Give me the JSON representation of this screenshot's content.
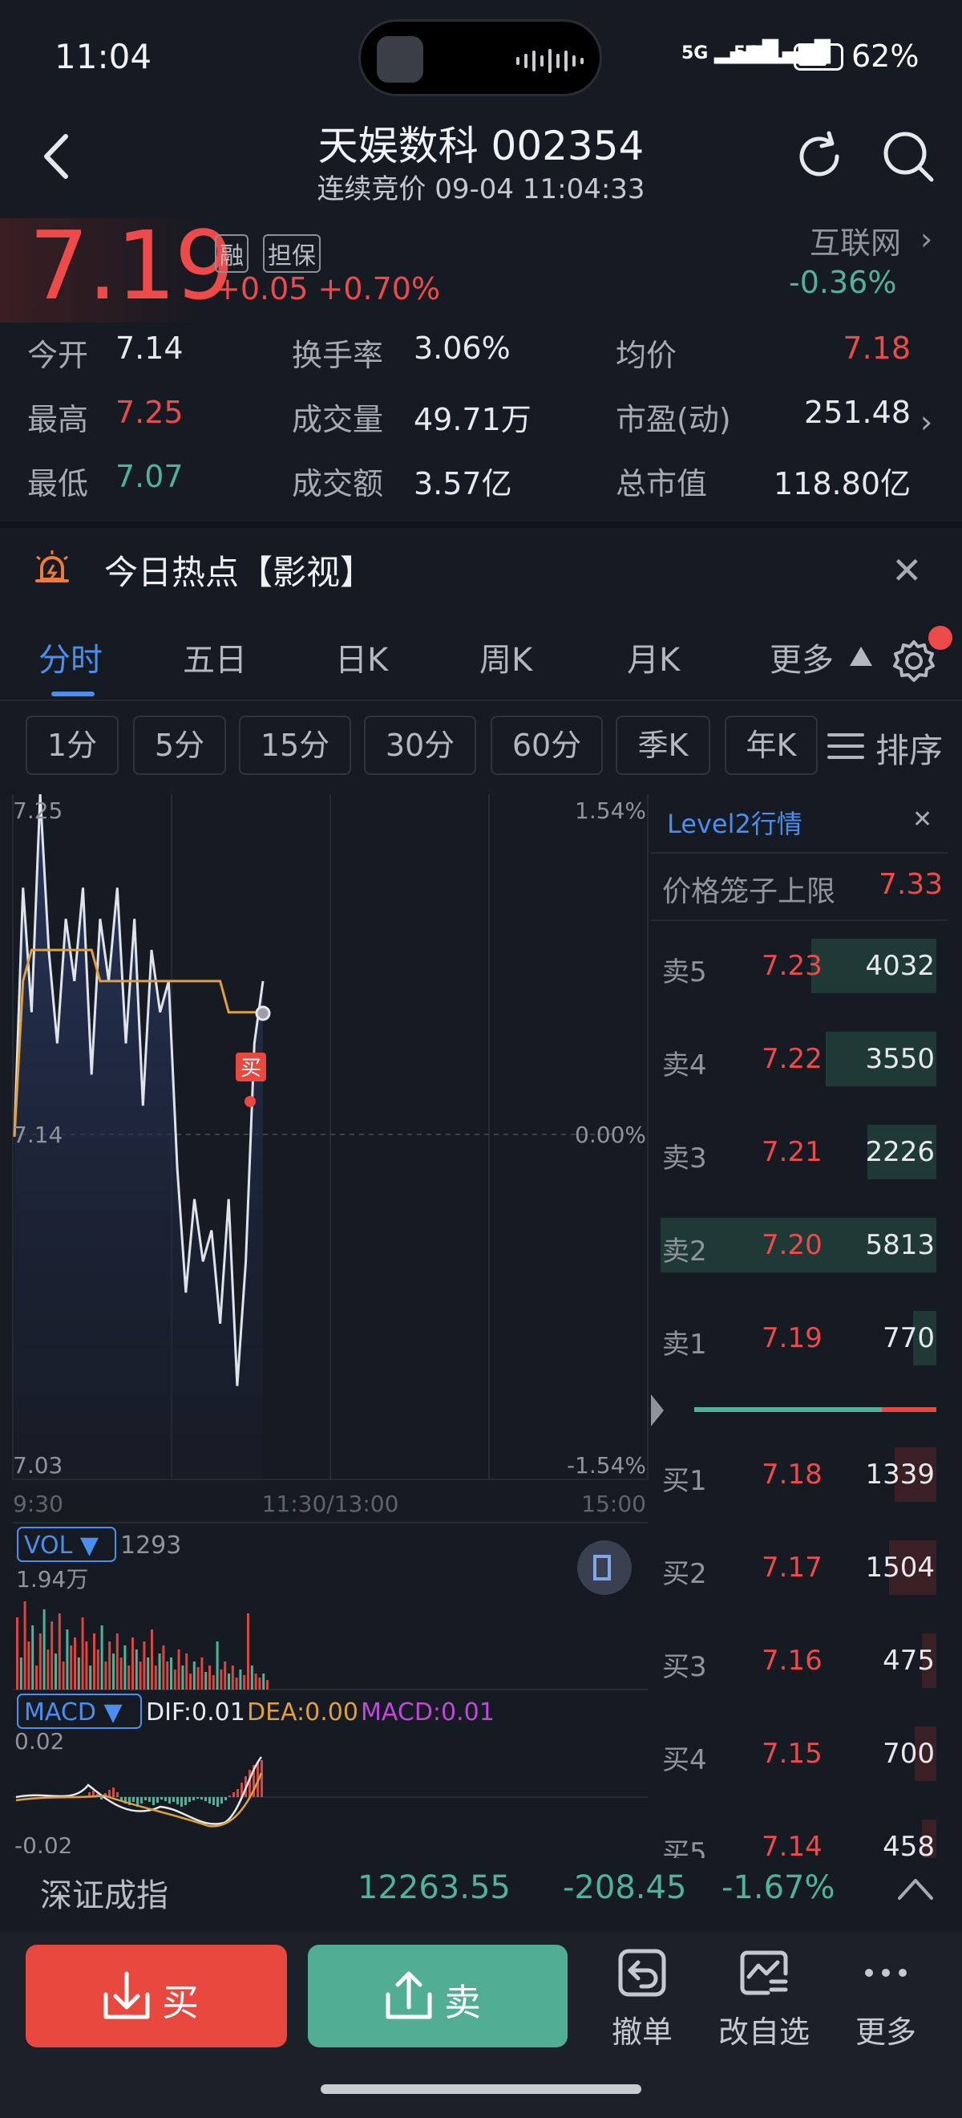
{
  "status_bar": {
    "time": "11:04",
    "signal1": "5G",
    "signal2": "5G",
    "battery_text": "62%",
    "battery_level": 0.62
  },
  "header": {
    "title": "天娱数科 002354",
    "subtitle": "连续竞价 09-04 11:04:33"
  },
  "quote": {
    "price": "7.19",
    "tag_rong": "融",
    "tag_danbao": "担保",
    "change": "+0.05 +0.70%",
    "sector": "互联网",
    "sector_change": "-0.36%"
  },
  "stats": {
    "open_label": "今开",
    "open": "7.14",
    "high_label": "最高",
    "high": "7.25",
    "low_label": "最低",
    "low": "7.07",
    "turnover_label": "换手率",
    "turnover": "3.06%",
    "volume_label": "成交量",
    "volume": "49.71万",
    "amount_label": "成交额",
    "amount": "3.57亿",
    "avg_label": "均价",
    "avg": "7.18",
    "pe_label": "市盈(动)",
    "pe": "251.48",
    "mcap_label": "总市值",
    "mcap": "118.80亿"
  },
  "hot": {
    "text": "今日热点【影视】"
  },
  "tabs": [
    "分时",
    "五日",
    "日K",
    "周K",
    "月K",
    "更多"
  ],
  "periods": [
    "1分",
    "5分",
    "15分",
    "30分",
    "60分",
    "季K",
    "年K"
  ],
  "sort_label": "排序",
  "chart": {
    "price_top": "7.25",
    "price_mid": "7.14",
    "price_bottom": "7.03",
    "pct_top": "1.54%",
    "pct_mid": "0.00%",
    "pct_bottom": "-1.54%",
    "time_start": "9:30",
    "time_mid": "11:30/13:00",
    "time_end": "15:00",
    "buy_marker": "买",
    "vol_label": "VOL ▼",
    "vol_value": "1293",
    "vol_max": "1.94万",
    "macd_label": "MACD ▼",
    "dif": "DIF:0.01",
    "dea": "DEA:0.00",
    "macd": "MACD:0.01",
    "macd_top": "0.02",
    "macd_bottom": "-0.02"
  },
  "chart_data": {
    "type": "line",
    "title": "",
    "xlabel": "",
    "ylabel": "",
    "x_range": [
      "9:30",
      "15:00"
    ],
    "ylim": [
      7.03,
      7.25
    ],
    "series": [
      {
        "values": [
          7.14,
          7.22,
          7.18,
          7.25,
          7.2,
          7.17,
          7.21,
          7.19,
          7.22,
          7.16,
          7.21,
          7.19,
          7.22,
          7.17,
          7.21,
          7.15,
          7.2,
          7.18,
          7.19,
          7.13,
          7.09,
          7.12,
          7.1,
          7.11,
          7.08,
          7.12,
          7.06,
          7.1,
          7.17,
          7.19
        ]
      },
      {
        "values": [
          7.14,
          7.19,
          7.2,
          7.2,
          7.2,
          7.2,
          7.2,
          7.2,
          7.2,
          7.2,
          7.19,
          7.19,
          7.19,
          7.19,
          7.19,
          7.19,
          7.19,
          7.19,
          7.19,
          7.19,
          7.19,
          7.19,
          7.19,
          7.19,
          7.19,
          7.18,
          7.18,
          7.18,
          7.18,
          7.18
        ]
      }
    ]
  },
  "level2": {
    "title": "Level2行情",
    "cage_label": "价格笼子上限",
    "cage_value": "7.33",
    "asks": [
      {
        "label": "卖5",
        "price": "7.23",
        "vol": "4032",
        "ratio": 0.69
      },
      {
        "label": "卖4",
        "price": "7.22",
        "vol": "3550",
        "ratio": 0.61
      },
      {
        "label": "卖3",
        "price": "7.21",
        "vol": "2226",
        "ratio": 0.38
      },
      {
        "label": "卖2",
        "price": "7.20",
        "vol": "5813",
        "ratio": 1.0
      },
      {
        "label": "卖1",
        "price": "7.19",
        "vol": "770",
        "ratio": 0.13
      }
    ],
    "bids": [
      {
        "label": "买1",
        "price": "7.18",
        "vol": "1339",
        "ratio": 0.23
      },
      {
        "label": "买2",
        "price": "7.17",
        "vol": "1504",
        "ratio": 0.26
      },
      {
        "label": "买3",
        "price": "7.16",
        "vol": "475",
        "ratio": 0.08
      },
      {
        "label": "买4",
        "price": "7.15",
        "vol": "700",
        "ratio": 0.12
      },
      {
        "label": "买5",
        "price": "7.14",
        "vol": "458",
        "ratio": 0.08
      }
    ]
  },
  "index": {
    "name": "深证成指",
    "value": "12263.55",
    "change": "-208.45",
    "pct": "-1.67%"
  },
  "actions": {
    "buy": "买",
    "sell": "卖",
    "cancel": "撤单",
    "watch": "改自选",
    "more": "更多"
  }
}
